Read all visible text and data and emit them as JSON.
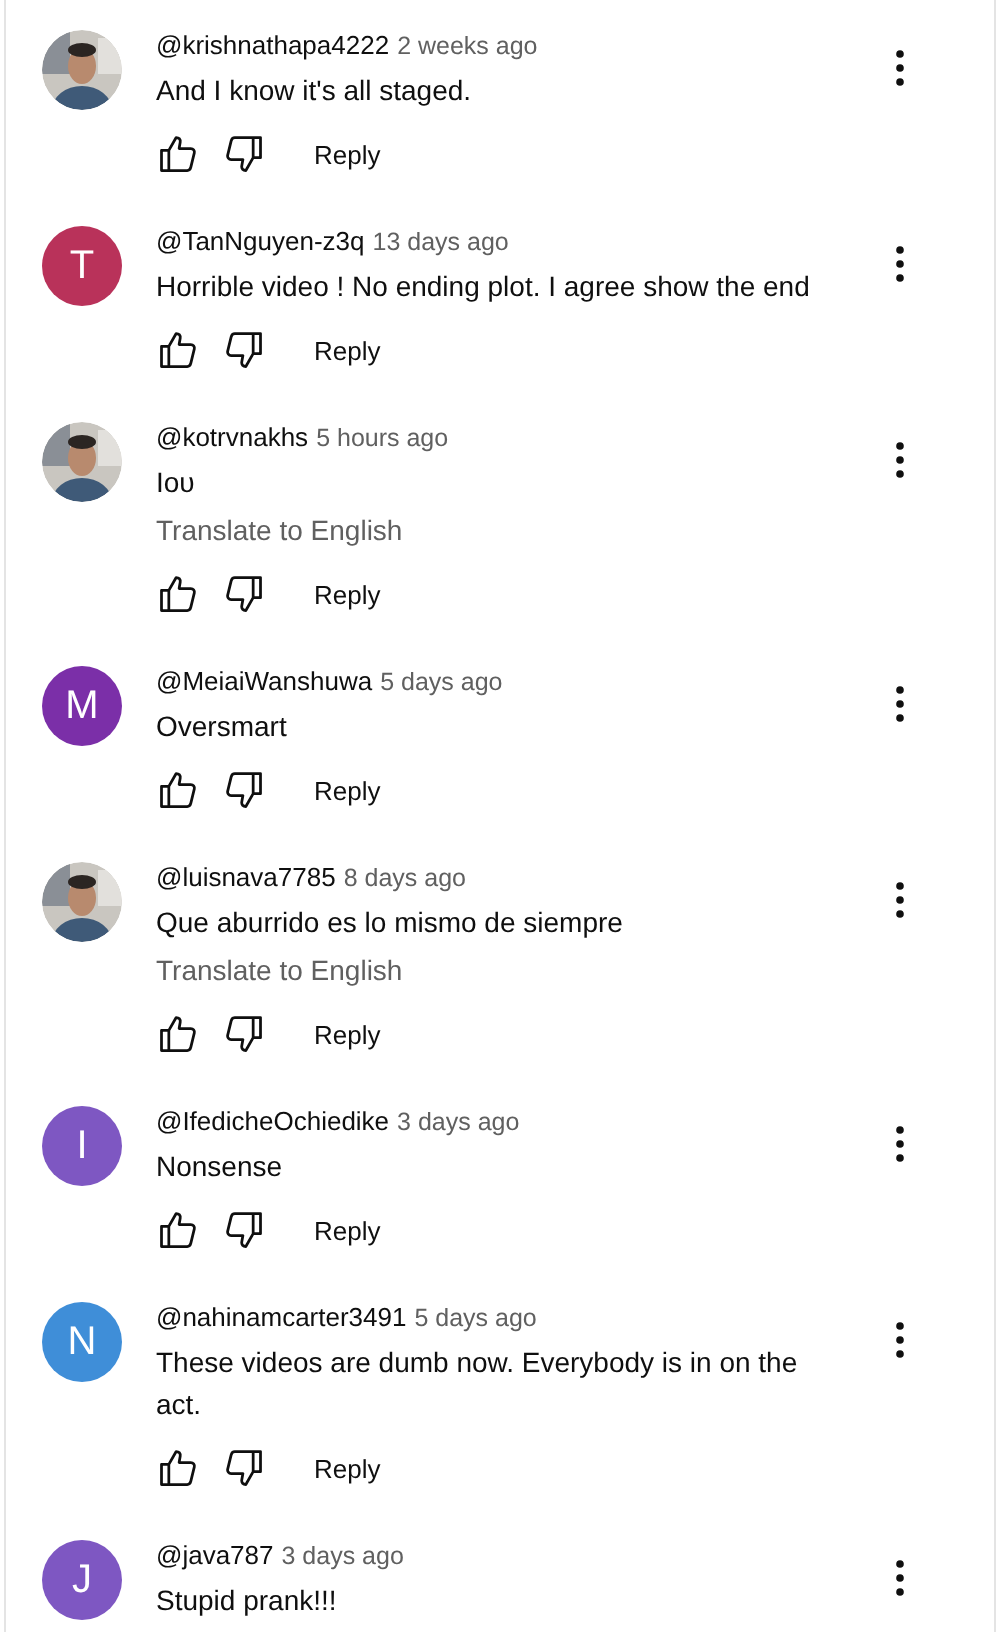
{
  "comments": [
    {
      "handle": "@krishnathapa4222",
      "time": "2 weeks ago",
      "text": "And I know it's  all staged.",
      "reply": "Reply"
    },
    {
      "avatar": {
        "kind": "letter",
        "letter": "T",
        "color": "#b9325a"
      },
      "handle": "@TanNguyen-z3q",
      "time": "13 days ago",
      "text": "Horrible video ! No ending plot. I agree show the end",
      "reply": "Reply"
    },
    {
      "handle": "@kotrvnakhs",
      "time": "5 hours ago",
      "text": "Ιου",
      "translate": "Translate to English",
      "reply": "Reply"
    },
    {
      "avatar": {
        "kind": "letter",
        "letter": "M",
        "color": "#7b2fa8"
      },
      "handle": "@MeiaiWanshuwa",
      "time": "5 days ago",
      "text": "Oversmart",
      "reply": "Reply"
    },
    {
      "handle": "@luisnava7785",
      "time": "8 days ago",
      "text": "Que aburrido es lo mismo de siempre",
      "translate": "Translate to English",
      "reply": "Reply"
    },
    {
      "avatar": {
        "kind": "letter",
        "letter": "I",
        "color": "#7e57c2"
      },
      "handle": "@IfedicheOchiedike",
      "time": "3 days ago",
      "text": "Nonsense",
      "reply": "Reply"
    },
    {
      "avatar": {
        "kind": "letter",
        "letter": "N",
        "color": "#3f8ed8"
      },
      "handle": "@nahinamcarter3491",
      "time": "5 days ago",
      "text": "These videos are dumb now. Everybody is in on the act.",
      "reply": "Reply"
    },
    {
      "avatar": {
        "kind": "letter",
        "letter": "J",
        "color": "#7e57c2"
      },
      "handle": "@java787",
      "time": "3 days ago",
      "text": "Stupid prank!!!"
    }
  ]
}
